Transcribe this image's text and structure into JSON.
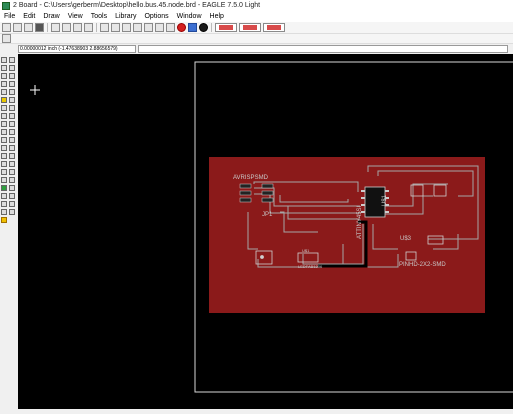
{
  "window": {
    "title": "2 Board - C:\\Users\\gerberm\\Desktop\\hello.bus.45.node.brd - EAGLE 7.5.0 Light"
  },
  "menu": [
    "File",
    "Edit",
    "Draw",
    "View",
    "Tools",
    "Library",
    "Options",
    "Window",
    "Help"
  ],
  "toolbar": {
    "main_icons": [
      "open-icon",
      "save-icon",
      "print-icon",
      "cam-icon",
      "board-icon",
      "schematic-icon",
      "ulp-icon",
      "script-icon",
      "zoom-fit-icon",
      "zoom-in-icon",
      "zoom-out-icon",
      "zoom-redraw-icon",
      "zoom-select-icon",
      "undo-icon",
      "redo-icon",
      "stop-icon",
      "go-icon",
      "help-icon"
    ],
    "eagle_buttons": [
      "eagle-ad-1",
      "eagle-ad-2",
      "eagle-ad-3"
    ]
  },
  "coordinate_display": "0.00000012 inch (-1.47638903 2.88656579)",
  "board_labels": {
    "avr_header": "AVRISPSMD",
    "jp1": "JP1",
    "attiny": "ATTINY45SI",
    "u_label": "U$1",
    "u3": "U$3",
    "led": "LEDFAB1206",
    "led_ref": "U$1",
    "pinhd": "PINHD-2X2-SMD"
  },
  "colors": {
    "canvas": "#000000",
    "board": "#8b1a1a",
    "trace": "#9a9a9a",
    "outline": "#d8d8d8"
  }
}
